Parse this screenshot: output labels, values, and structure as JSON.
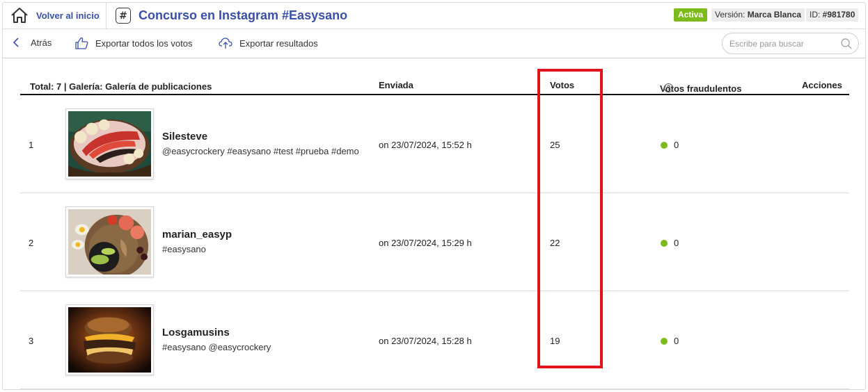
{
  "header": {
    "home_label": "Volver al inicio",
    "contest_icon_glyph": "#",
    "title": "Concurso en Instagram #Easysano",
    "status": "Activa",
    "version_prefix": "Versión: ",
    "version_value": "Marca Blanca",
    "id_prefix": "ID: ",
    "id_value": "#981780",
    "status_color": "#7dbb1d",
    "title_color": "#3a4fa8"
  },
  "toolbar": {
    "back_label": "Atrás",
    "export_votes_label": "Exportar todos los votos",
    "export_results_label": "Exportar resultados",
    "search_placeholder": "Escribe para buscar",
    "icons": [
      "chevron-left-icon",
      "thumbs-up-icon",
      "cloud-upload-icon",
      "search-icon"
    ]
  },
  "table": {
    "columns": {
      "info": "Total: 7 | Galería: Galería de publicaciones",
      "sent": "Enviada",
      "votes": "Votos",
      "fraud": "Votos fraudulentos",
      "actions": "Acciones"
    },
    "help_icon": "?",
    "rows": [
      {
        "num": "1",
        "user": "Silesteve",
        "tags": "@easycrockery #easysano #test #prueba #demo",
        "date": "on 23/07/2024, 15:52 h",
        "votes": "25",
        "fraud": "0",
        "image": "smoothie-bowl"
      },
      {
        "num": "2",
        "user": "marian_easyp",
        "tags": "#easysano",
        "date": "on 23/07/2024, 15:29 h",
        "votes": "22",
        "fraud": "0",
        "image": "healthy-plate"
      },
      {
        "num": "3",
        "user": "Losgamusins",
        "tags": "#easysano @easycrockery",
        "date": "on 23/07/2024, 15:28 h",
        "votes": "19",
        "fraud": "0",
        "image": "burger"
      }
    ]
  },
  "highlight_color": "#e2141b",
  "fraud_dot_color": "#7dbb1d"
}
